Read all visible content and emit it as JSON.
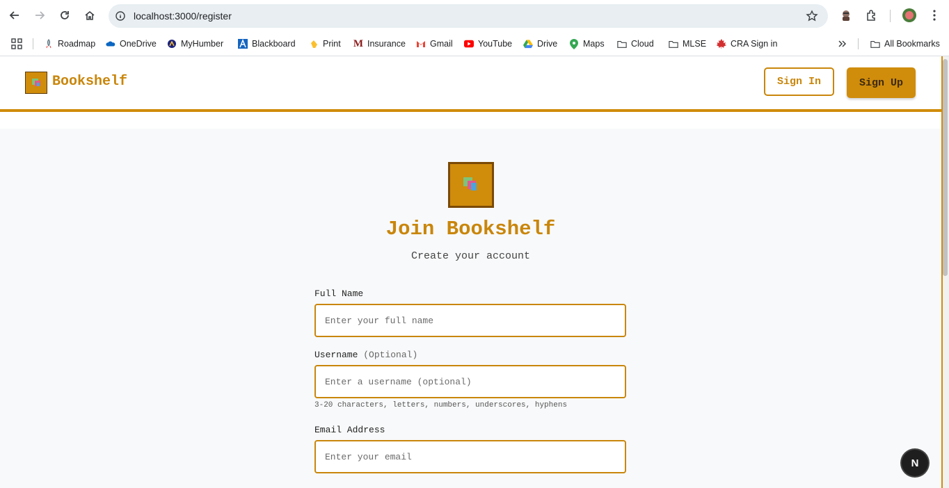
{
  "browser": {
    "url": "localhost:3000/register",
    "bookmarks": [
      "Roadmap",
      "OneDrive",
      "MyHumber",
      "Blackboard",
      "Print",
      "Insurance",
      "Gmail",
      "YouTube",
      "Drive",
      "Maps",
      "Cloud",
      "MLSE",
      "CRA Sign in"
    ],
    "all_bookmarks": "All Bookmarks"
  },
  "header": {
    "brand": "Bookshelf",
    "sign_in": "Sign In",
    "sign_up": "Sign Up"
  },
  "form": {
    "title": "Join Bookshelf",
    "subtitle": "Create your account",
    "full_name": {
      "label": "Full Name",
      "placeholder": "Enter your full name"
    },
    "username": {
      "label": "Username",
      "optional": "(Optional)",
      "placeholder": "Enter a username (optional)",
      "hint": "3-20 characters, letters, numbers, underscores, hyphens"
    },
    "email": {
      "label": "Email Address",
      "placeholder": "Enter your email"
    }
  },
  "dev_badge": "N",
  "colors": {
    "accent": "#d08c0b",
    "accent_text": "#c9860b",
    "page_bg": "#f8f9fa"
  }
}
